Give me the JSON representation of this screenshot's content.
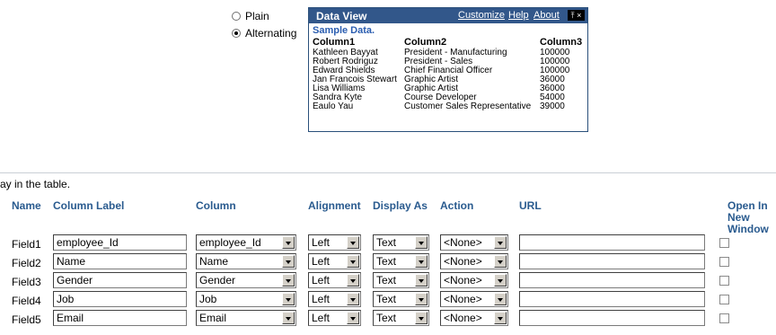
{
  "style_options": {
    "plain_label": "Plain",
    "alternating_label": "Alternating",
    "selected": "Alternating"
  },
  "data_view": {
    "title": "Data View",
    "links": {
      "customize": "Customize",
      "help": "Help",
      "about": "About"
    },
    "icons": "⤒ ×",
    "subtitle": "Sample Data.",
    "headers": [
      "Column1",
      "Column2",
      "Column3"
    ],
    "rows": [
      [
        "Kathleen Bayyat",
        "President - Manufacturing",
        "100000"
      ],
      [
        "Robert Rodriguz",
        "President - Sales",
        "100000"
      ],
      [
        "Edward Shields",
        "Chief Financial Officer",
        "100000"
      ],
      [
        "Jan Francois Stewart",
        "Graphic Artist",
        "36000"
      ],
      [
        "Lisa Williams",
        "Graphic Artist",
        "36000"
      ],
      [
        "Sandra Kyte",
        "Course Developer",
        "54000"
      ],
      [
        "Eaulo Yau",
        "Customer Sales Representative",
        "39000"
      ]
    ]
  },
  "help_text": "ay in the table.",
  "table": {
    "headers": {
      "name": "Name",
      "column_label": "Column Label",
      "column": "Column",
      "alignment": "Alignment",
      "display_as": "Display As",
      "action": "Action",
      "url": "URL",
      "open_new_window": "Open In New Window"
    },
    "fields": [
      {
        "name": "Field1",
        "label": "employee_Id",
        "column": "employee_Id",
        "alignment": "Left",
        "display_as": "Text",
        "action": "<None>",
        "url": "",
        "open_new_window": false
      },
      {
        "name": "Field2",
        "label": "Name",
        "column": "Name",
        "alignment": "Left",
        "display_as": "Text",
        "action": "<None>",
        "url": "",
        "open_new_window": false
      },
      {
        "name": "Field3",
        "label": "Gender",
        "column": "Gender",
        "alignment": "Left",
        "display_as": "Text",
        "action": "<None>",
        "url": "",
        "open_new_window": false
      },
      {
        "name": "Field4",
        "label": "Job",
        "column": "Job",
        "alignment": "Left",
        "display_as": "Text",
        "action": "<None>",
        "url": "",
        "open_new_window": false
      },
      {
        "name": "Field5",
        "label": "Email",
        "column": "Email",
        "alignment": "Left",
        "display_as": "Text",
        "action": "<None>",
        "url": "",
        "open_new_window": false
      }
    ]
  },
  "colors": {
    "header_blue": "#32578a",
    "column_header": "#2a5b8f",
    "subtitle": "#2a5db0"
  }
}
